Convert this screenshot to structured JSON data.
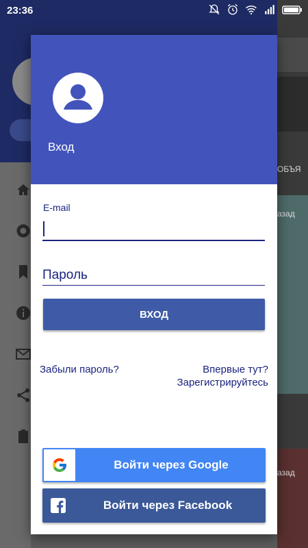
{
  "status_bar": {
    "time": "23:36",
    "icons": [
      "muted-bell-icon",
      "alarm-icon",
      "wifi-icon",
      "signal-icon",
      "battery-icon"
    ]
  },
  "background": {
    "side_label_1": "ОБЪЯ",
    "side_label_2": "азад",
    "side_label_3": "азад"
  },
  "dialog": {
    "title": "Вход",
    "email_label": "E-mail",
    "email_value": "",
    "password_placeholder": "Пароль",
    "login_button": "ВХОД",
    "forgot_link": "Забыли пароль?",
    "first_time_link": "Впервые тут?",
    "register_link": "Зарегистрируйтесь",
    "google_button": "Войти через Google",
    "facebook_button": "Войти через Facebook"
  },
  "colors": {
    "header": "#4254bb",
    "accent": "#1a237e",
    "login_button": "#3f5ba8",
    "google": "#4285f4",
    "facebook": "#3b5998"
  }
}
